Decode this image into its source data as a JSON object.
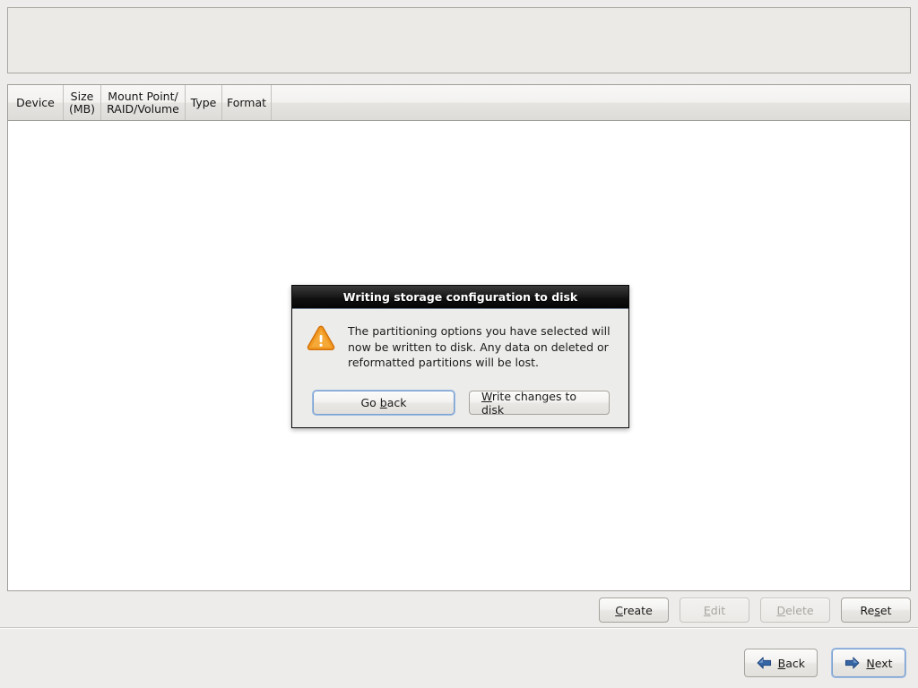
{
  "drive_panel": {
    "name": "drive-graphic-panel",
    "content": ""
  },
  "partition_table": {
    "columns": [
      {
        "label": "Device",
        "key": "device"
      },
      {
        "label": "Size\n(MB)",
        "key": "size_mb"
      },
      {
        "label": "Mount Point/\nRAID/Volume",
        "key": "mount_point"
      },
      {
        "label": "Type",
        "key": "type"
      },
      {
        "label": "Format",
        "key": "format"
      },
      {
        "label": "",
        "key": "filler"
      }
    ],
    "rows": []
  },
  "action_buttons": [
    {
      "label": "Create",
      "mnemonic": "C",
      "enabled": true
    },
    {
      "label": "Edit",
      "mnemonic": "E",
      "enabled": false
    },
    {
      "label": "Delete",
      "mnemonic": "D",
      "enabled": false
    },
    {
      "label": "Reset",
      "mnemonic": "s",
      "enabled": true
    }
  ],
  "action_button_labels": {
    "create_pre": "",
    "create_mn": "C",
    "create_post": "reate",
    "edit_pre": "",
    "edit_mn": "E",
    "edit_post": "dit",
    "delete_pre": "",
    "delete_mn": "D",
    "delete_post": "elete",
    "reset_pre": "Re",
    "reset_mn": "s",
    "reset_post": "et"
  },
  "nav_buttons": {
    "back_pre": "",
    "back_mn": "B",
    "back_post": "ack",
    "next_pre": "",
    "next_mn": "N",
    "next_post": "ext",
    "back_icon": "arrow-left-icon",
    "next_icon": "arrow-right-icon",
    "back_label": "Back",
    "next_label": "Next",
    "next_focused": true
  },
  "dialog": {
    "title": "Writing storage configuration to disk",
    "icon": "warning-triangle-icon",
    "message": "The partitioning options you have selected will now be written to disk.  Any data on deleted or reformatted partitions will be lost.",
    "buttons": {
      "go_back_pre": "Go ",
      "go_back_mn": "b",
      "go_back_post": "ack",
      "go_back_label": "Go back",
      "write_pre": "",
      "write_mn": "W",
      "write_post": "rite changes to disk",
      "write_label": "Write changes to disk",
      "go_back_focused": true
    }
  },
  "colors": {
    "window_bg": "#edecea",
    "panel_bg": "#eceae7",
    "list_bg": "#ffffff",
    "border": "#a09e99",
    "dialog_title_bg": "#101010",
    "dialog_body_bg": "#ececea",
    "warning_orange": "#f08b1d",
    "focus_blue": "#7a9fd0",
    "arrow_blue": "#3465a4",
    "disabled_text": "#a9a6a1"
  }
}
